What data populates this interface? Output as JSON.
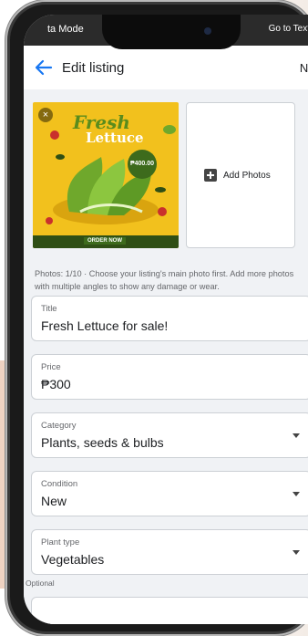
{
  "status": {
    "left": "ta Mode",
    "right": "Go to Text"
  },
  "appbar": {
    "title": "Edit listing",
    "next": "Nex"
  },
  "photo": {
    "headline1": "Fresh",
    "headline2": "Lettuce",
    "order_button": "ORDER NOW",
    "price_badge": "₱400.00",
    "close": "×"
  },
  "add_photos": {
    "label": "Add Photos"
  },
  "photos_hint": "Photos: 1/10 · Choose your listing's main photo first. Add more photos with multiple angles to show any damage or wear.",
  "fields": {
    "title": {
      "label": "Title",
      "value": "Fresh Lettuce for sale!"
    },
    "price": {
      "label": "Price",
      "value": "₱300"
    },
    "category": {
      "label": "Category",
      "value": "Plants, seeds & bulbs"
    },
    "condition": {
      "label": "Condition",
      "value": "New"
    },
    "plant_type": {
      "label": "Plant type",
      "value": "Vegetables"
    }
  },
  "optional_label": "Optional",
  "colors": {
    "accent": "#1877f2",
    "lettuce_green": "#5a8c1d",
    "poster_yellow": "#f2c11d"
  }
}
